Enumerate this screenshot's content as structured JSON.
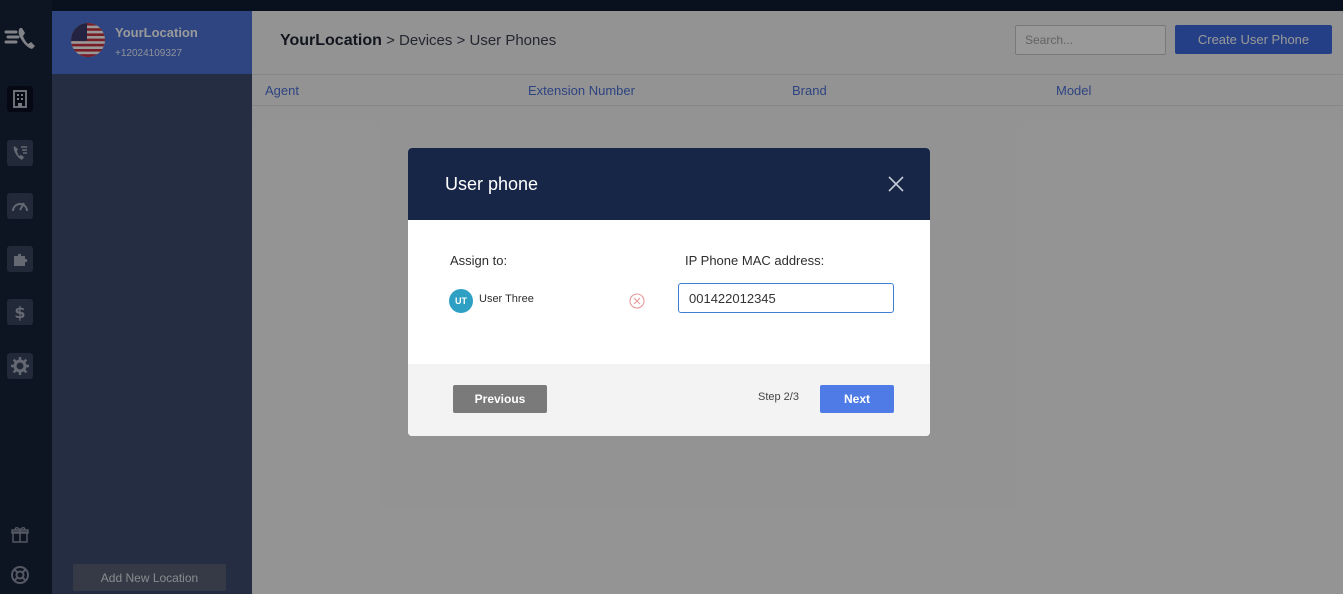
{
  "location": {
    "name": "YourLocation",
    "phone": "+12024109327",
    "add_label": "Add New Location"
  },
  "breadcrumb": {
    "root": "YourLocation",
    "sep": " > ",
    "level1": "Devices",
    "level2": "User Phones"
  },
  "toolbar": {
    "search_placeholder": "Search...",
    "create_label": "Create User Phone"
  },
  "table": {
    "columns": [
      "Agent",
      "Extension Number",
      "Brand",
      "Model"
    ]
  },
  "nav": {
    "items": [
      "logo-icon",
      "building-icon",
      "call-flow-icon",
      "gauge-icon",
      "puzzle-icon",
      "dollar-icon",
      "gear-icon",
      "gift-icon",
      "lifebuoy-icon"
    ]
  },
  "modal": {
    "title": "User phone",
    "assign_label": "Assign to:",
    "mac_label": "IP Phone MAC address:",
    "user_initials": "UT",
    "user_name": "User Three",
    "mac_value": "001422012345",
    "previous_label": "Previous",
    "step_text": "Step 2/3",
    "next_label": "Next"
  },
  "colors": {
    "accent": "#3d6ae0",
    "header_dark": "#172647",
    "avatar": "#2ea0c4",
    "remove": "#e08080"
  }
}
